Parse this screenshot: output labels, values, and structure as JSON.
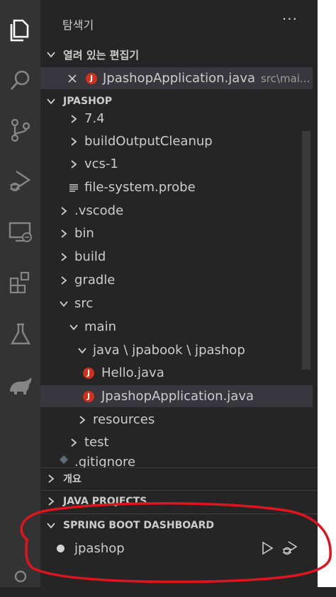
{
  "sidebar": {
    "title": "탐색기",
    "more_label": "···"
  },
  "open_editors": {
    "header": "열려 있는 편집기",
    "file": "JpashopApplication.java",
    "path": "src\\mai..."
  },
  "project": {
    "header": "JPASHOP",
    "rows": [
      {
        "label": "7.4"
      },
      {
        "label": "buildOutputCleanup"
      },
      {
        "label": "vcs-1"
      },
      {
        "label": "file-system.probe"
      },
      {
        "label": ".vscode"
      },
      {
        "label": "bin"
      },
      {
        "label": "build"
      },
      {
        "label": "gradle"
      },
      {
        "label": "src"
      },
      {
        "label": "main"
      },
      {
        "label": "java \\ jpabook \\ jpashop"
      },
      {
        "label": "Hello.java"
      },
      {
        "label": "JpashopApplication.java"
      },
      {
        "label": "resources"
      },
      {
        "label": "test"
      },
      {
        "label": ".gitignore"
      }
    ]
  },
  "outline": {
    "header": "개요"
  },
  "java_projects": {
    "header": "JAVA PROJECTS"
  },
  "spring_boot": {
    "header": "SPRING BOOT DASHBOARD",
    "app": "jpashop"
  },
  "icons": {
    "java_glyph": "J"
  },
  "colors": {
    "annotation": "#e0141e",
    "java_icon": "#d0311f",
    "selected_row": "#37373d"
  }
}
